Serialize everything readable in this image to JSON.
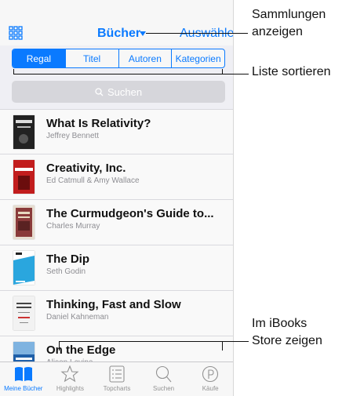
{
  "navbar": {
    "title": "Bücher",
    "action": "Auswählen"
  },
  "segments": [
    {
      "label": "Regal",
      "active": true
    },
    {
      "label": "Titel",
      "active": false
    },
    {
      "label": "Autoren",
      "active": false
    },
    {
      "label": "Kategorien",
      "active": false
    }
  ],
  "search": {
    "placeholder": "Suchen"
  },
  "books": [
    {
      "title": "What Is Relativity?",
      "author": "Jeffrey Bennett",
      "cover": "#222222"
    },
    {
      "title": "Creativity, Inc.",
      "author": "Ed Catmull & Amy Wallace",
      "cover": "#c21d1d"
    },
    {
      "title": "The Curmudgeon's Guide to...",
      "author": "Charles Murray",
      "cover": "#8a3a3a"
    },
    {
      "title": "The Dip",
      "author": "Seth Godin",
      "cover": "#2aa6de"
    },
    {
      "title": "Thinking, Fast and Slow",
      "author": "Daniel Kahneman",
      "cover": "#f2f2f2"
    },
    {
      "title": "On the Edge",
      "author": "Alison Levine",
      "cover": "#1f5fa8"
    }
  ],
  "tabs": [
    {
      "label": "Meine Bücher",
      "icon": "open-book-icon",
      "active": true
    },
    {
      "label": "Highlights",
      "icon": "star-icon",
      "active": false
    },
    {
      "label": "Topcharts",
      "icon": "list-icon",
      "active": false
    },
    {
      "label": "Suchen",
      "icon": "search-icon",
      "active": false
    },
    {
      "label": "Käufe",
      "icon": "purchases-icon",
      "active": false
    }
  ],
  "callouts": {
    "collections": [
      "Sammlungen",
      "anzeigen"
    ],
    "sort": "Liste sortieren",
    "store": [
      "Im iBooks",
      "Store zeigen"
    ]
  },
  "colors": {
    "accent": "#0a7aff"
  }
}
